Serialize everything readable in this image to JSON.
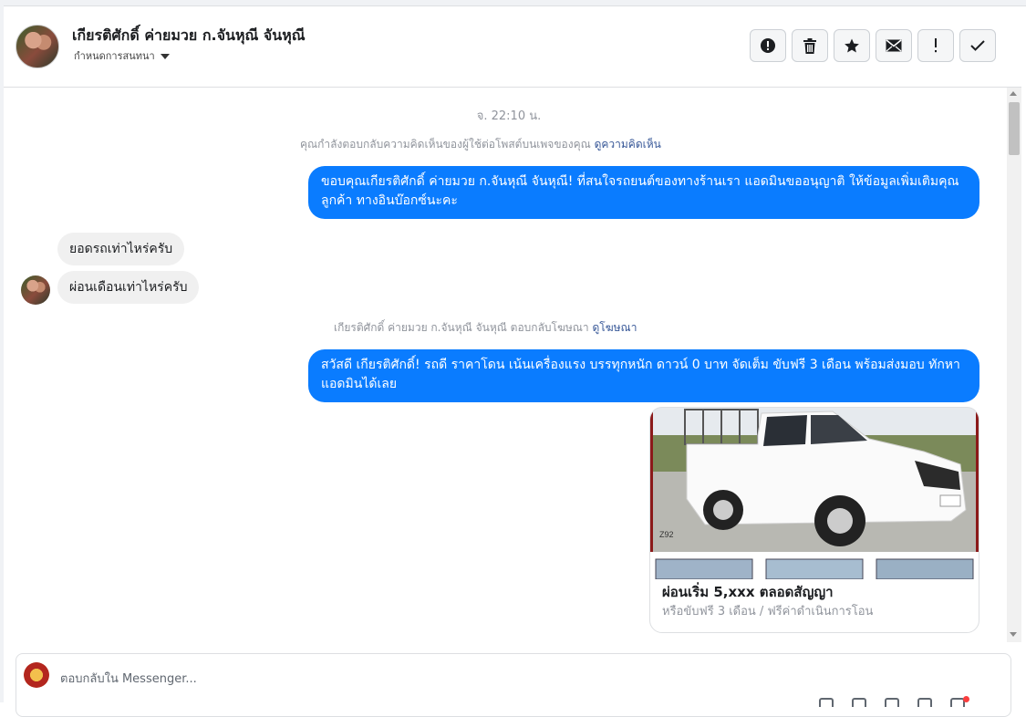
{
  "header": {
    "contact_name": "เกียรติศักดิ์ ค่ายมวย ก.จันหุณี จันหุณี",
    "assign_label": "กำหนดการสนทนา",
    "actions": [
      {
        "icon": "alert-circle-icon"
      },
      {
        "icon": "trash-icon"
      },
      {
        "icon": "star-icon"
      },
      {
        "icon": "envelope-icon"
      },
      {
        "icon": "exclamation-icon"
      },
      {
        "icon": "check-icon"
      }
    ]
  },
  "thread": {
    "timestamp": "จ. 22:10 น.",
    "comment_reply_note": "คุณกำลังตอบกลับความคิดเห็นของผู้ใช้ต่อโพสต์บนเพจของคุณ",
    "comment_reply_link": "ดูความคิดเห็น",
    "msg_out_1": "ขอบคุณเกียรติศักดิ์ ค่ายมวย ก.จันหุณี จันหุณี! ที่สนใจรถยนต์ของทางร้านเรา แอดมินขออนุญาติ ให้ข้อมูลเพิ่มเติมคุณลูกค้า ทางอินบ๊อกซ์นะคะ",
    "msg_in_1": "ยอดรถเท่าไหร่ครับ",
    "msg_in_2": "ผ่อนเดือนเท่าไหร่ครับ",
    "ad_reply_note": "เกียรติศักดิ์ ค่ายมวย ก.จันหุณี จันหุณี ตอบกลับโฆษณา",
    "ad_reply_link": "ดูโฆษณา",
    "msg_out_2": "สวัสดี เกียรติศักดิ์! รถดี ราคาโดน เน้นเครื่องแรง บรรทุกหนัก ดาวน์ 0 บาท จัดเต็ม ขับฟรี 3 เดือน พร้อมส่งมอบ ทักหาแอดมินได้เลย",
    "card": {
      "image_stamp": "Z92",
      "title": "ผ่อนเริ่ม 5,xxx ตลอดสัญญา",
      "subtitle": "หรือขับฟรี 3 เดือน / ฟรีค่าดำเนินการโอน"
    }
  },
  "composer": {
    "placeholder": "ตอบกลับใน Messenger..."
  }
}
